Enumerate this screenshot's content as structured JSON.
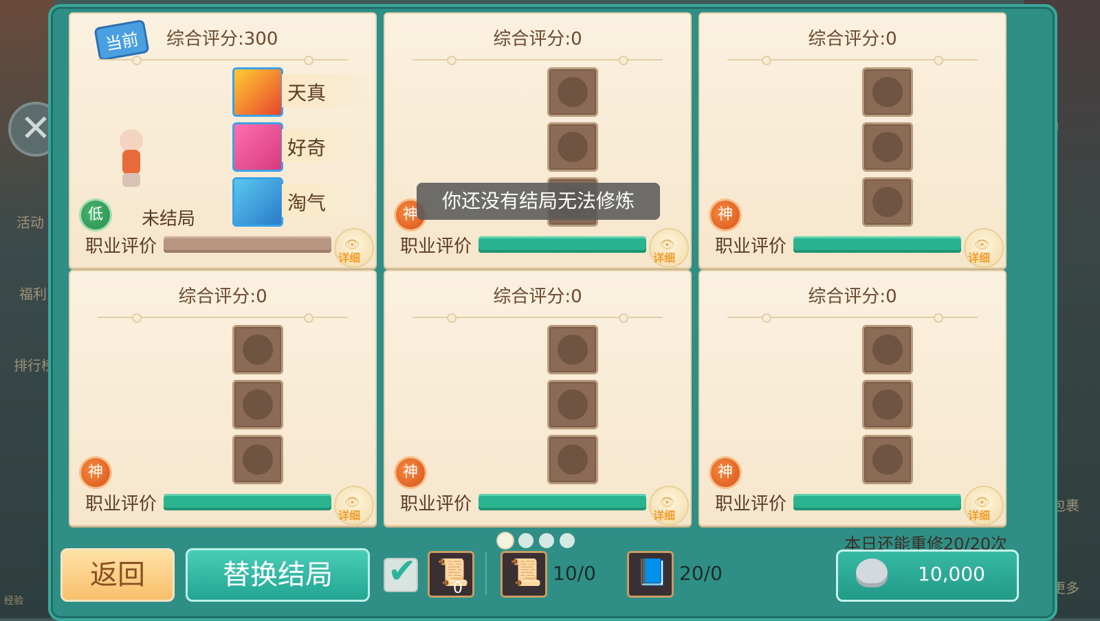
{
  "cards": [
    {
      "score": "综合评分:300",
      "tag": "当前",
      "grade": "低",
      "status": "未结局",
      "prof_label": "职业评价",
      "detail": "详细",
      "traits": [
        {
          "label": "天真"
        },
        {
          "label": "好奇"
        },
        {
          "label": "淘气"
        }
      ]
    },
    {
      "score": "综合评分:0",
      "grade": "神",
      "prof_label": "职业评价",
      "detail": "详细"
    },
    {
      "score": "综合评分:0",
      "grade": "神",
      "prof_label": "职业评价",
      "detail": "详细"
    },
    {
      "score": "综合评分:0",
      "grade": "神",
      "prof_label": "职业评价",
      "detail": "详细"
    },
    {
      "score": "综合评分:0",
      "grade": "神",
      "prof_label": "职业评价",
      "detail": "详细"
    },
    {
      "score": "综合评分:0",
      "grade": "神",
      "prof_label": "职业评价",
      "detail": "详细"
    }
  ],
  "toast": "你还没有结局无法修炼",
  "daily": "本日还能重修20/20次",
  "bottom": {
    "back": "返回",
    "replace": "替换结局",
    "scroll_small_count": "0",
    "scroll_count": "10/0",
    "book_count": "20/0",
    "silver": "10,000"
  },
  "bg": {
    "number": "240",
    "labels": [
      "活动",
      "活动",
      "福利",
      "排行榜",
      "经验",
      "包裹",
      "更多"
    ]
  },
  "colors": {
    "frame": "#2f8f86",
    "bar": "#2ab38f",
    "card": "#f8ecd6"
  }
}
